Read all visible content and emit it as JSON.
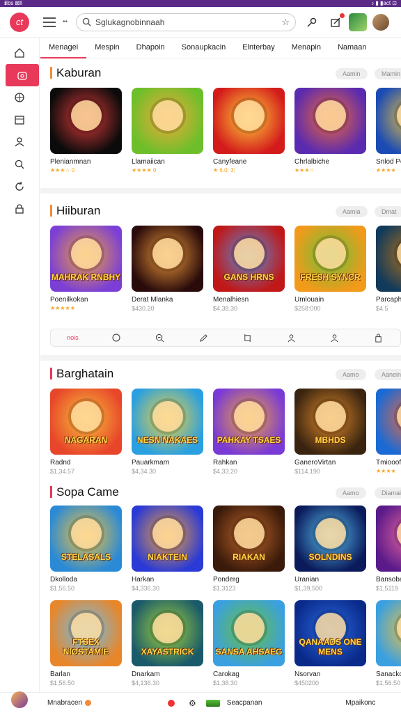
{
  "statusbar": {
    "left": "ℹ︎lbs ⊠ll",
    "right": "♪ ▮ ▮act ⊡"
  },
  "topbar": {
    "logo": "ct",
    "dots": "••",
    "search_text": "Sglukagnobinnaah"
  },
  "tabs": [
    "Menagei",
    "Mespin",
    "Dhapoin",
    "Sonaupkacin",
    "Elnterbay",
    "Menapin",
    "Namaan"
  ],
  "sections": [
    {
      "title": "Kaburan",
      "pills": [
        "Aamin",
        "Mamin"
      ],
      "cards": [
        {
          "name": "Plenianmnan",
          "sub": "★★★☆ 0",
          "img": "",
          "colors": [
            "#0b0b0b",
            "#e33b3b"
          ]
        },
        {
          "name": "Llamaiican",
          "sub": "★★★★ 0",
          "img": "",
          "colors": [
            "#6cbf2a",
            "#f6a93a"
          ]
        },
        {
          "name": "Canyfeane",
          "sub": "★ 6.0; 3;",
          "img": "",
          "colors": [
            "#d31b1b",
            "#ffd23a"
          ]
        },
        {
          "name": "Chrlalbiche",
          "sub": "★★★☆",
          "img": "",
          "colors": [
            "#5a2ab0",
            "#f06a3a"
          ]
        },
        {
          "name": "Snlod Po",
          "sub": "★★★★",
          "img": "",
          "colors": [
            "#1a4bb5",
            "#f2c43a"
          ]
        }
      ]
    },
    {
      "title": "Hiiburan",
      "pills": [
        "Aamia",
        "Dmat"
      ],
      "cards": [
        {
          "name": "Poenilkokan",
          "sub": "★★★★★",
          "img": "MAHRAK RNBHY",
          "colors": [
            "#7b3fd6",
            "#f2a13a"
          ]
        },
        {
          "name": "Derat Mlanka",
          "sub": "$430.20",
          "img": "",
          "colors": [
            "#2a0b0b",
            "#f09a3a"
          ]
        },
        {
          "name": "Menalhiesn",
          "sub": "$4,38.30",
          "img": "GANS HRNS",
          "colors": [
            "#c01818",
            "#5a8bd6"
          ]
        },
        {
          "name": "Umlouain",
          "sub": "$258:000",
          "img": "FRESH SYNCR",
          "colors": [
            "#f29a1a",
            "#6ac03a"
          ]
        },
        {
          "name": "Parcaph",
          "sub": "$4.5",
          "img": "",
          "colors": [
            "#123a5a",
            "#b8731a"
          ]
        }
      ]
    },
    {
      "title": "Barghatain",
      "pills": [
        "Aamo",
        "Aanein"
      ],
      "cards": [
        {
          "name": "Radnd",
          "sub": "$1,34.57",
          "img": "NAGARAN",
          "colors": [
            "#e8462a",
            "#f6c23a"
          ]
        },
        {
          "name": "Pauarkmarn",
          "sub": "$4,34.30",
          "img": "NESN NAKAES",
          "colors": [
            "#2aa0e0",
            "#f6d23a"
          ]
        },
        {
          "name": "Rahkan",
          "sub": "$4,33.20",
          "img": "PAHKAY TSAES",
          "colors": [
            "#7a3ad6",
            "#f2a63a"
          ]
        },
        {
          "name": "GaneroVirtan",
          "sub": "$114.190",
          "img": "MBHDS",
          "colors": [
            "#3a2410",
            "#e08a2a"
          ]
        },
        {
          "name": "Tmiooof",
          "sub": "★★★★",
          "img": "",
          "colors": [
            "#1a6ad6",
            "#f26a3a"
          ]
        }
      ]
    },
    {
      "title": "Sopa Came",
      "pills": [
        "Aamo",
        "Diamai"
      ],
      "cards": [
        {
          "name": "Dkolloda",
          "sub": "$1,56.50",
          "img": "STELASALS",
          "colors": [
            "#2a8ad6",
            "#f6c23a"
          ]
        },
        {
          "name": "Harkan",
          "sub": "$4,336.30",
          "img": "NIAKTEIN",
          "colors": [
            "#2a3ad6",
            "#f2a23a"
          ]
        },
        {
          "name": "Ponderg",
          "sub": "$1,3123",
          "img": "RIAKAN",
          "colors": [
            "#3a1a0a",
            "#c0662a"
          ]
        },
        {
          "name": "Uranian",
          "sub": "$1,39,500",
          "img": "SOLNDINS",
          "colors": [
            "#0a1a5a",
            "#5ac0f0"
          ]
        },
        {
          "name": "Bansoba",
          "sub": "$1,5119",
          "img": "",
          "colors": [
            "#5a1a8a",
            "#f06aa0"
          ]
        }
      ]
    },
    {
      "title": "",
      "pills": [],
      "cards": [
        {
          "name": "Barlan",
          "sub": "$1,56.50",
          "img": "FTSEX NIOSTAMIE",
          "colors": [
            "#e8862a",
            "#6ac0f0"
          ]
        },
        {
          "name": "Dnarkam",
          "sub": "$4,136.30",
          "img": "XAYASTRICK",
          "colors": [
            "#1a5a6a",
            "#a6d63a"
          ]
        },
        {
          "name": "Carokag",
          "sub": "$1,38.30",
          "img": "SANSA AHSAEG",
          "colors": [
            "#3aa0e0",
            "#6ac03a"
          ]
        },
        {
          "name": "Nsorvan",
          "sub": "$450200",
          "img": "QANAADS ONE MENS",
          "colors": [
            "#0a2a8a",
            "#2a6ae0"
          ]
        },
        {
          "name": "Sanackc",
          "sub": "$1,56.50",
          "img": "BOI",
          "colors": [
            "#3aa0e0",
            "#f6c23a"
          ]
        }
      ]
    }
  ],
  "toolbar": {
    "first": "nois"
  },
  "bottombar": {
    "left": "Mnabracen",
    "right_mid": "Seacpanan",
    "right": "Mpaikonc"
  }
}
